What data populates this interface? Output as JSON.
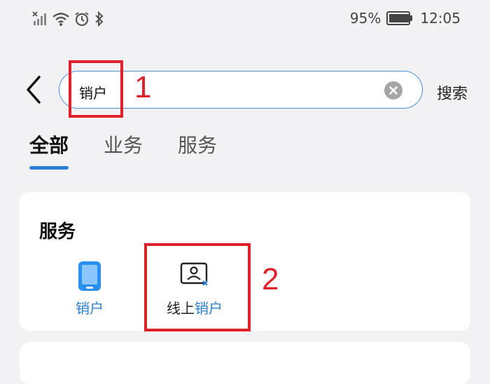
{
  "status_bar": {
    "battery_percent": "95%",
    "time": "12:05",
    "icons": [
      "signal-off-icon",
      "wifi-icon",
      "alarm-icon",
      "bluetooth-icon",
      "battery-icon"
    ]
  },
  "search": {
    "value": "销户",
    "search_button": "搜索"
  },
  "tabs": [
    {
      "label": "全部",
      "active": true
    },
    {
      "label": "业务",
      "active": false
    },
    {
      "label": "服务",
      "active": false
    }
  ],
  "services_section": {
    "title": "服务",
    "items": [
      {
        "label": "销户",
        "icon": "phone-icon"
      },
      {
        "label_prefix": "线上",
        "label_highlight": "销户",
        "icon": "account-cancel-icon"
      }
    ]
  },
  "annotations": [
    "1",
    "2"
  ],
  "colors": {
    "accent": "#2b7fd4",
    "annotation": "#e0202a",
    "background": "#f2f2f4"
  }
}
